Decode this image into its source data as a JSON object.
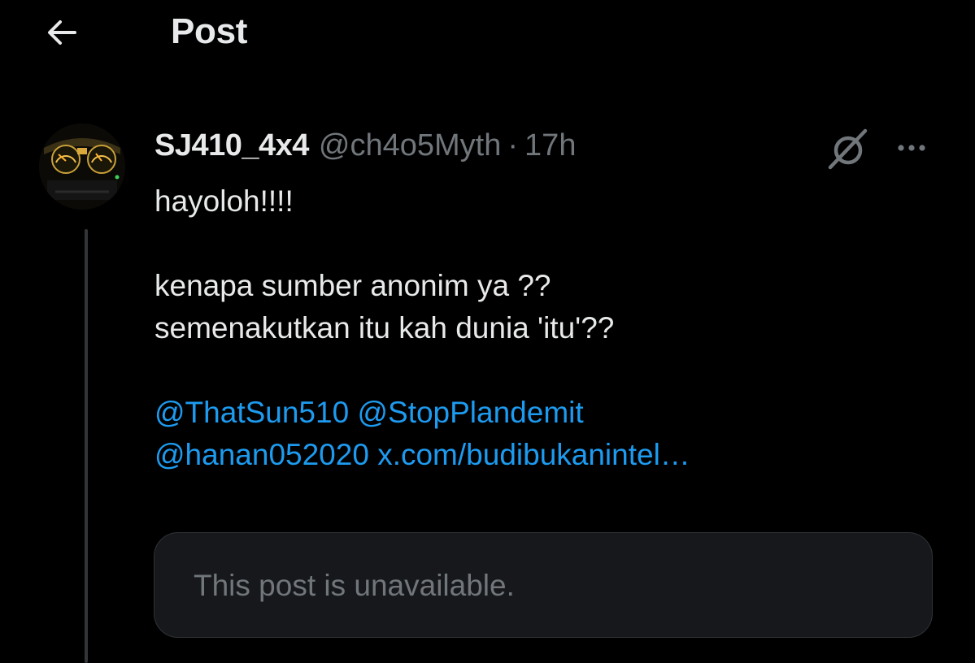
{
  "header": {
    "title": "Post",
    "back_icon": "arrow-left-icon"
  },
  "post": {
    "avatar_icon": "dashboard-gauge-avatar",
    "display_name": "SJ410_4x4",
    "handle": "@ch4o5Myth",
    "separator": "·",
    "time": "17h",
    "grok_icon": "grok-icon",
    "more_icon": "more-dots-icon",
    "text_line1": "hayoloh!!!!",
    "text_line2": "kenapa sumber anonim ya ??",
    "text_line3": "semenakutkan itu kah dunia 'itu'??",
    "mention1": "@ThatSun510",
    "mention2": "@StopPlandemit",
    "mention3": "@hanan052020",
    "link": "x.com/budibukanintel…",
    "quote_unavailable": "This post is unavailable."
  },
  "colors": {
    "background": "#000000",
    "text_primary": "#e7e9ea",
    "text_secondary": "#71767b",
    "link": "#1d9bf0",
    "card_bg": "#16181c",
    "thread_line": "#333639"
  }
}
